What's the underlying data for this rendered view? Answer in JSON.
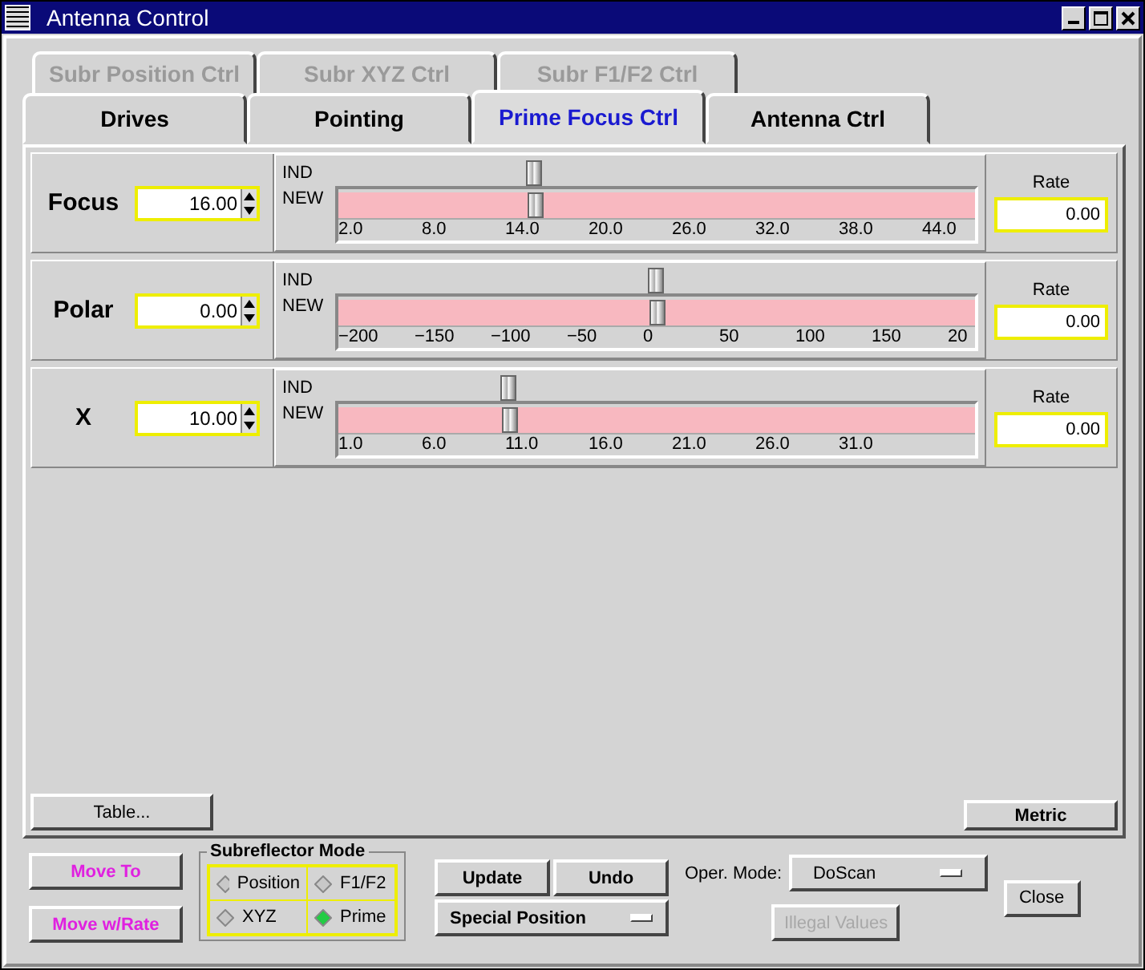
{
  "window": {
    "title": "Antenna Control"
  },
  "tab_rows": [
    {
      "tabs": [
        {
          "label": "Subr Position Ctrl",
          "selected": false,
          "disabled": true
        },
        {
          "label": "Subr XYZ Ctrl",
          "selected": false,
          "disabled": true
        },
        {
          "label": "Subr F1/F2 Ctrl",
          "selected": false,
          "disabled": true
        }
      ]
    },
    {
      "tabs": [
        {
          "label": "Drives",
          "selected": false,
          "disabled": false
        },
        {
          "label": "Pointing",
          "selected": false,
          "disabled": false
        },
        {
          "label": "Prime Focus Ctrl",
          "selected": true,
          "disabled": false
        },
        {
          "label": "Antenna Ctrl",
          "selected": false,
          "disabled": false
        }
      ]
    }
  ],
  "axes": [
    {
      "name": "Focus",
      "value": "16.00",
      "ind_label": "IND",
      "new_label": "NEW",
      "indicator": {
        "level": 0.31
      },
      "new": {
        "level": 0.31
      },
      "ticks": [
        "2.0",
        "8.0",
        "14.0",
        "20.0",
        "26.0",
        "32.0",
        "38.0",
        "44.0"
      ],
      "rate_label": "Rate",
      "rate": "0.00"
    },
    {
      "name": "Polar",
      "value": "0.00",
      "ind_label": "IND",
      "new_label": "NEW",
      "indicator": {
        "level": 0.5
      },
      "new": {
        "level": 0.5
      },
      "ticks": [
        "−200",
        "−150",
        "−100",
        "−50",
        "0",
        "50",
        "100",
        "150",
        "20"
      ],
      "rate_label": "Rate",
      "rate": "0.00"
    },
    {
      "name": "X",
      "value": "10.00",
      "ind_label": "IND",
      "new_label": "NEW",
      "indicator": {
        "level": 0.27
      },
      "new": {
        "level": 0.27
      },
      "ticks": [
        "1.0",
        "6.0",
        "11.0",
        "16.0",
        "21.0",
        "26.0",
        "31.0"
      ],
      "rate_label": "Rate",
      "rate": "0.00"
    }
  ],
  "table_button": "Table...",
  "metric_button": "Metric",
  "move_buttons": [
    "Move To",
    "Move w/Rate"
  ],
  "subreflector_mode": {
    "title": "Subreflector Mode",
    "options": [
      {
        "label": "Position",
        "selected": false
      },
      {
        "label": "F1/F2",
        "selected": false
      },
      {
        "label": "XYZ",
        "selected": false
      },
      {
        "label": "Prime",
        "selected": true
      }
    ]
  },
  "update_button": "Update",
  "undo_button": "Undo",
  "special_position": "Special Position",
  "oper_mode": {
    "label": "Oper. Mode:",
    "value": "DoScan"
  },
  "illegal_values": {
    "label": "Illegal Values",
    "disabled": true
  },
  "close_button": "Close"
}
